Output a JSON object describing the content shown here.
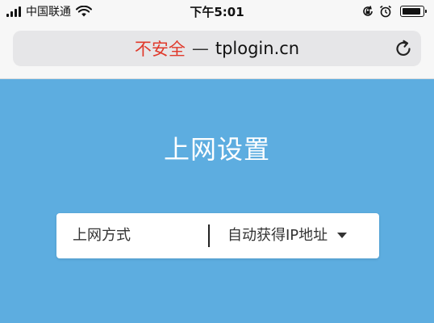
{
  "status_bar": {
    "carrier": "中国联通",
    "time": "下午5:01",
    "icons": [
      "signal-icon",
      "wifi-icon",
      "orientation-lock-icon",
      "alarm-icon",
      "battery-icon"
    ],
    "battery_level": 0.9
  },
  "address_bar": {
    "security_label": "不安全",
    "separator": "—",
    "domain": "tplogin.cn",
    "reload_icon": "reload-icon"
  },
  "page": {
    "title": "上网设置",
    "connection_field": {
      "label": "上网方式",
      "selected_value": "自动获得IP地址",
      "dropdown_icon": "caret-down-icon"
    }
  },
  "colors": {
    "page_background": "#5dade0",
    "insecure_text": "#e0392b",
    "card_background": "#ffffff",
    "browser_chrome": "#f7f7f7"
  }
}
